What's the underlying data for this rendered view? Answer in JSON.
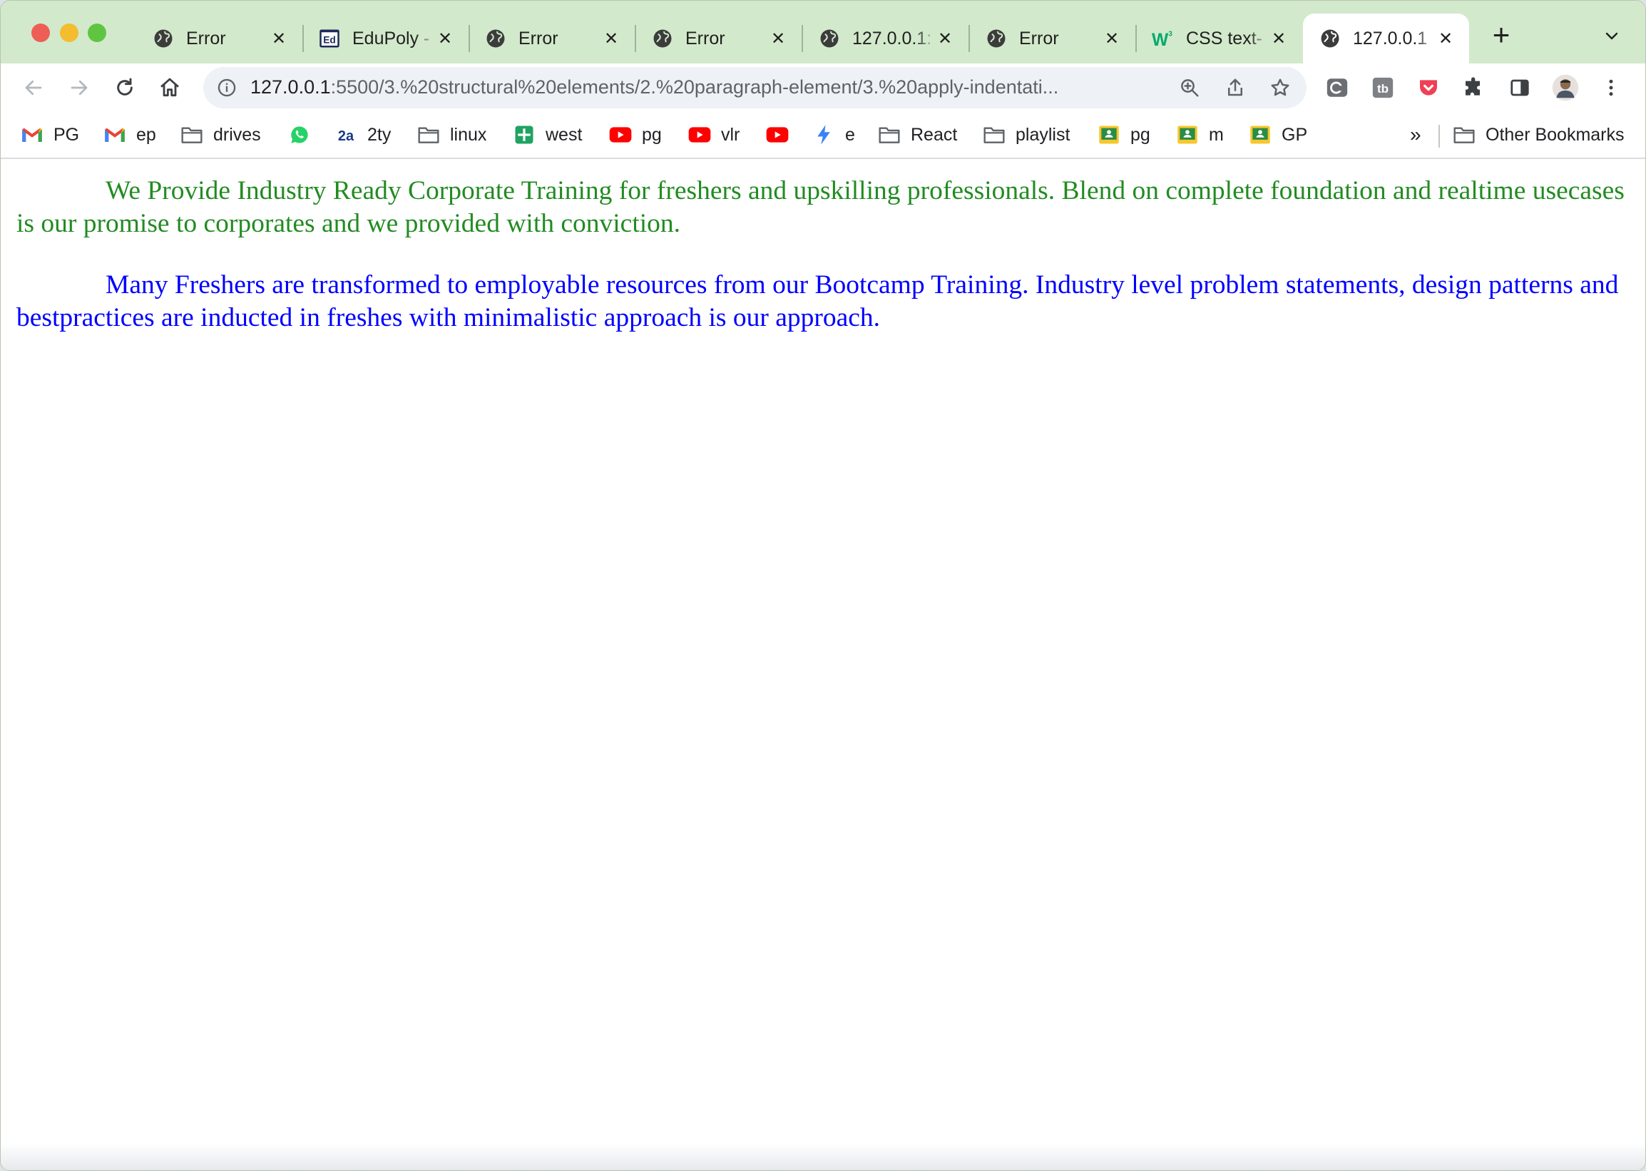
{
  "tabs": [
    {
      "title": "Error",
      "favicon": "globe-icon",
      "active": false
    },
    {
      "title": "EduPoly -",
      "favicon": "edupoly-logo-icon",
      "active": false
    },
    {
      "title": "Error",
      "favicon": "globe-icon",
      "active": false
    },
    {
      "title": "Error",
      "favicon": "globe-icon",
      "active": false
    },
    {
      "title": "127.0.0.1:",
      "favicon": "globe-icon",
      "active": false
    },
    {
      "title": "Error",
      "favicon": "globe-icon",
      "active": false
    },
    {
      "title": "CSS text-",
      "favicon": "w3schools-icon",
      "active": false
    },
    {
      "title": "127.0.0.1",
      "favicon": "globe-icon",
      "active": true
    }
  ],
  "address_bar": {
    "host": "127.0.0.1",
    "path": ":5500/3.%20structural%20elements/2.%20paragraph-element/3.%20apply-indentati..."
  },
  "bookmarks": [
    {
      "label": "PG",
      "icon": "gmail-icon"
    },
    {
      "label": "ep",
      "icon": "gmail-icon"
    },
    {
      "label": "drives",
      "icon": "folder-icon"
    },
    {
      "label": "",
      "icon": "whatsapp-icon"
    },
    {
      "label": "2ty",
      "icon": "2a-icon"
    },
    {
      "label": "linux",
      "icon": "folder-icon"
    },
    {
      "label": "west",
      "icon": "sheets-icon"
    },
    {
      "label": "pg",
      "icon": "youtube-icon"
    },
    {
      "label": "vlr",
      "icon": "youtube-icon"
    },
    {
      "label": "",
      "icon": "youtube-icon"
    },
    {
      "label": "e",
      "icon": "bolt-icon"
    },
    {
      "label": "React",
      "icon": "folder-icon"
    },
    {
      "label": "playlist",
      "icon": "folder-icon"
    },
    {
      "label": "pg",
      "icon": "classroom-icon"
    },
    {
      "label": "m",
      "icon": "classroom-icon"
    },
    {
      "label": "GP",
      "icon": "classroom-icon"
    }
  ],
  "bookmarks_overflow": "»",
  "other_bookmarks": "Other Bookmarks",
  "tab_glyphs": {
    "close": "✕",
    "new_tab": "+"
  },
  "colors": {
    "paragraph1": "#228b22",
    "paragraph2": "#0000ff",
    "tab_strip": "#d3e9cb"
  },
  "paragraphs": [
    {
      "text": "We Provide Industry Ready Corporate Training for freshers and upskilling professionals. Blend on complete foundation and realtime usecases is our promise to corporates and we provided with conviction.",
      "color": "#228b22"
    },
    {
      "text": "Many Freshers are transformed to employable resources from our Bootcamp Training. Industry level problem statements, design patterns and bestpractices are inducted in freshes with minimalistic approach is our approach.",
      "color": "#0000ff"
    }
  ]
}
